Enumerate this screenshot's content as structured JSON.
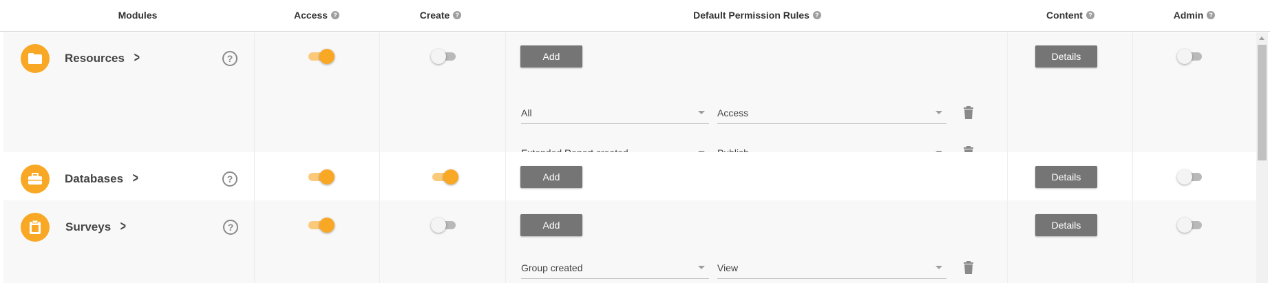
{
  "header": {
    "modules": "Modules",
    "access": "Access",
    "create": "Create",
    "rules": "Default Permission Rules",
    "content": "Content",
    "admin": "Admin",
    "help_glyph": "?"
  },
  "modules": [
    {
      "name": "Resources",
      "icon": "folder-icon",
      "access": true,
      "create": false,
      "admin": false,
      "add_label": "Add",
      "details_label": "Details",
      "rules": [
        {
          "condition": "All",
          "permission": "Access"
        },
        {
          "condition": "Extended Report created",
          "permission": "Publish"
        }
      ]
    },
    {
      "name": "Databases",
      "icon": "toolbox-icon",
      "access": true,
      "create": true,
      "admin": false,
      "add_label": "Add",
      "details_label": "Details",
      "rules": []
    },
    {
      "name": "Surveys",
      "icon": "clipboard-icon",
      "access": true,
      "create": false,
      "admin": false,
      "add_label": "Add",
      "details_label": "Details",
      "rules": [
        {
          "condition": "Group created",
          "permission": "View"
        }
      ]
    }
  ],
  "colors": {
    "accent": "#f9a825",
    "accent_track": "#fbc97a",
    "button": "#757575"
  }
}
